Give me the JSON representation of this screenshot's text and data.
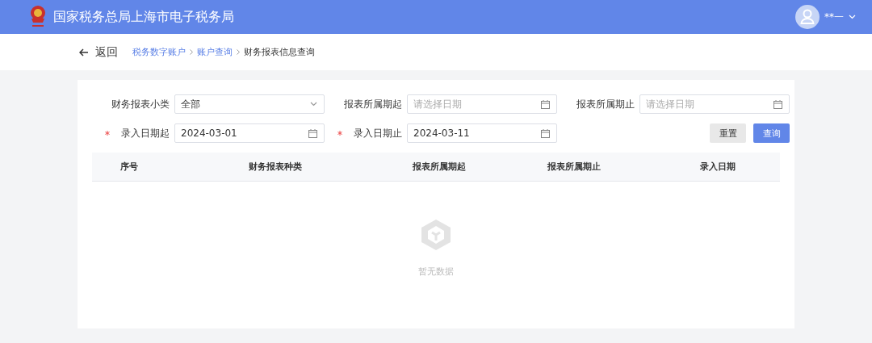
{
  "header": {
    "title": "国家税务总局上海市电子税务局",
    "user": "**一"
  },
  "nav": {
    "back": "返回",
    "breadcrumb": [
      {
        "label": "税务数字账户",
        "link": true
      },
      {
        "label": "账户查询",
        "link": true
      },
      {
        "label": "财务报表信息查询",
        "link": false
      }
    ]
  },
  "filters": [
    {
      "kind": "select",
      "label": "财务报表小类",
      "required": false,
      "value": "全部"
    },
    {
      "kind": "date",
      "label": "报表所属期起",
      "required": false,
      "placeholder": "请选择日期"
    },
    {
      "kind": "date",
      "label": "报表所属期止",
      "required": false,
      "placeholder": "请选择日期"
    },
    {
      "kind": "date",
      "label": "录入日期起",
      "required": true,
      "value": "2024-03-01"
    },
    {
      "kind": "date",
      "label": "录入日期止",
      "required": true,
      "value": "2024-03-11"
    }
  ],
  "buttons": [
    {
      "label": "重置",
      "kind": "default"
    },
    {
      "label": "查询",
      "kind": "primary"
    }
  ],
  "table": {
    "columns": [
      "序号",
      "财务报表种类",
      "报表所属期起",
      "报表所属期止",
      "录入日期"
    ],
    "empty_text": "暂无数据"
  }
}
